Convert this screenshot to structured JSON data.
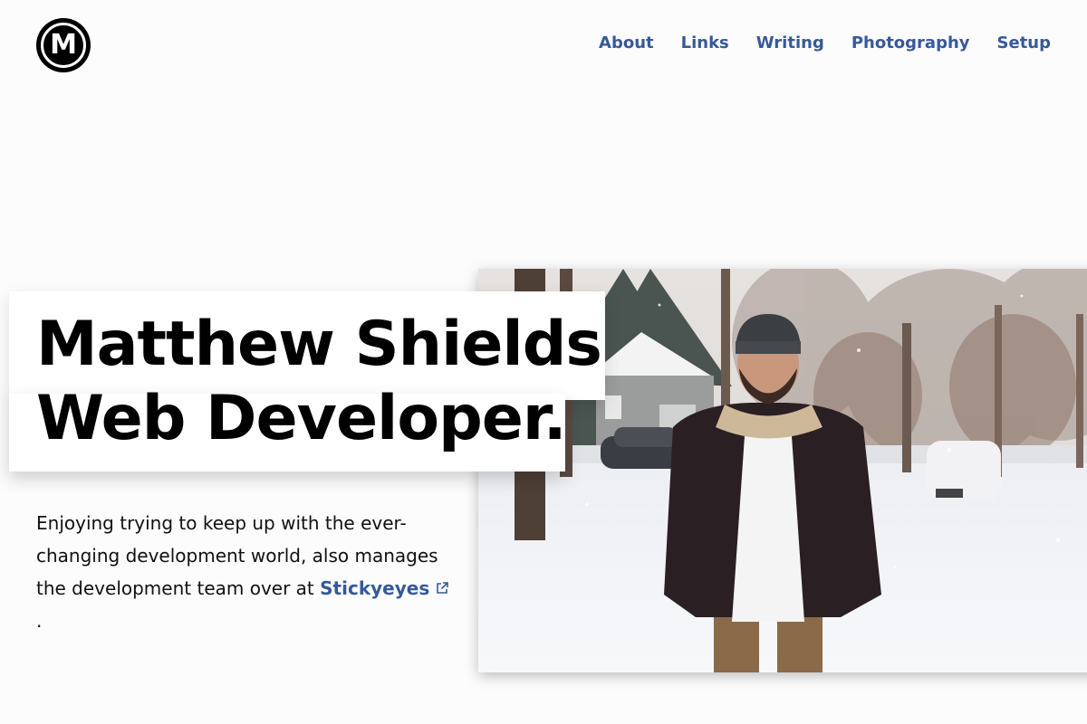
{
  "header": {
    "logo_letter": "M",
    "nav": [
      {
        "label": "About"
      },
      {
        "label": "Links"
      },
      {
        "label": "Writing"
      },
      {
        "label": "Photography"
      },
      {
        "label": "Setup"
      }
    ]
  },
  "hero": {
    "title_line1": "Matthew Shields",
    "title_line2": "Web Developer.",
    "intro_text": "Enjoying trying to keep up with the ever-changing development world, also manages the development team over at",
    "intro_link": "Stickyeyes",
    "intro_end": ".",
    "link_icon": "external-link-icon",
    "photo_icon": "portrait-photo"
  },
  "colors": {
    "link": "#36599a",
    "background": "#fcfcfc",
    "text": "#000000"
  }
}
